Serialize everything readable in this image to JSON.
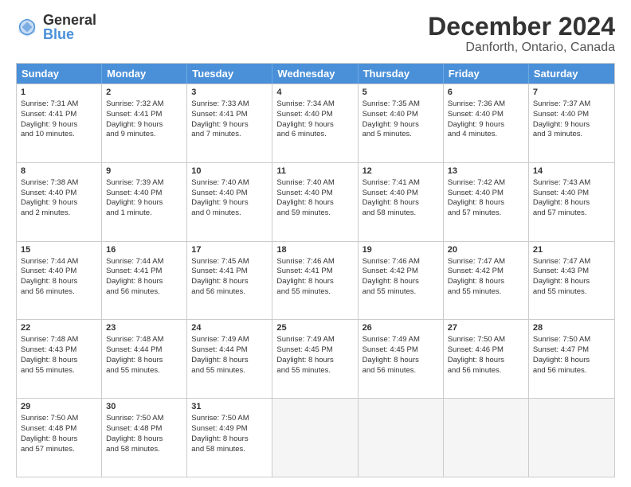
{
  "logo": {
    "general": "General",
    "blue": "Blue"
  },
  "title": "December 2024",
  "subtitle": "Danforth, Ontario, Canada",
  "days": [
    "Sunday",
    "Monday",
    "Tuesday",
    "Wednesday",
    "Thursday",
    "Friday",
    "Saturday"
  ],
  "weeks": [
    [
      {
        "num": "1",
        "lines": [
          "Sunrise: 7:31 AM",
          "Sunset: 4:41 PM",
          "Daylight: 9 hours",
          "and 10 minutes."
        ]
      },
      {
        "num": "2",
        "lines": [
          "Sunrise: 7:32 AM",
          "Sunset: 4:41 PM",
          "Daylight: 9 hours",
          "and 9 minutes."
        ]
      },
      {
        "num": "3",
        "lines": [
          "Sunrise: 7:33 AM",
          "Sunset: 4:41 PM",
          "Daylight: 9 hours",
          "and 7 minutes."
        ]
      },
      {
        "num": "4",
        "lines": [
          "Sunrise: 7:34 AM",
          "Sunset: 4:40 PM",
          "Daylight: 9 hours",
          "and 6 minutes."
        ]
      },
      {
        "num": "5",
        "lines": [
          "Sunrise: 7:35 AM",
          "Sunset: 4:40 PM",
          "Daylight: 9 hours",
          "and 5 minutes."
        ]
      },
      {
        "num": "6",
        "lines": [
          "Sunrise: 7:36 AM",
          "Sunset: 4:40 PM",
          "Daylight: 9 hours",
          "and 4 minutes."
        ]
      },
      {
        "num": "7",
        "lines": [
          "Sunrise: 7:37 AM",
          "Sunset: 4:40 PM",
          "Daylight: 9 hours",
          "and 3 minutes."
        ]
      }
    ],
    [
      {
        "num": "8",
        "lines": [
          "Sunrise: 7:38 AM",
          "Sunset: 4:40 PM",
          "Daylight: 9 hours",
          "and 2 minutes."
        ]
      },
      {
        "num": "9",
        "lines": [
          "Sunrise: 7:39 AM",
          "Sunset: 4:40 PM",
          "Daylight: 9 hours",
          "and 1 minute."
        ]
      },
      {
        "num": "10",
        "lines": [
          "Sunrise: 7:40 AM",
          "Sunset: 4:40 PM",
          "Daylight: 9 hours",
          "and 0 minutes."
        ]
      },
      {
        "num": "11",
        "lines": [
          "Sunrise: 7:40 AM",
          "Sunset: 4:40 PM",
          "Daylight: 8 hours",
          "and 59 minutes."
        ]
      },
      {
        "num": "12",
        "lines": [
          "Sunrise: 7:41 AM",
          "Sunset: 4:40 PM",
          "Daylight: 8 hours",
          "and 58 minutes."
        ]
      },
      {
        "num": "13",
        "lines": [
          "Sunrise: 7:42 AM",
          "Sunset: 4:40 PM",
          "Daylight: 8 hours",
          "and 57 minutes."
        ]
      },
      {
        "num": "14",
        "lines": [
          "Sunrise: 7:43 AM",
          "Sunset: 4:40 PM",
          "Daylight: 8 hours",
          "and 57 minutes."
        ]
      }
    ],
    [
      {
        "num": "15",
        "lines": [
          "Sunrise: 7:44 AM",
          "Sunset: 4:40 PM",
          "Daylight: 8 hours",
          "and 56 minutes."
        ]
      },
      {
        "num": "16",
        "lines": [
          "Sunrise: 7:44 AM",
          "Sunset: 4:41 PM",
          "Daylight: 8 hours",
          "and 56 minutes."
        ]
      },
      {
        "num": "17",
        "lines": [
          "Sunrise: 7:45 AM",
          "Sunset: 4:41 PM",
          "Daylight: 8 hours",
          "and 56 minutes."
        ]
      },
      {
        "num": "18",
        "lines": [
          "Sunrise: 7:46 AM",
          "Sunset: 4:41 PM",
          "Daylight: 8 hours",
          "and 55 minutes."
        ]
      },
      {
        "num": "19",
        "lines": [
          "Sunrise: 7:46 AM",
          "Sunset: 4:42 PM",
          "Daylight: 8 hours",
          "and 55 minutes."
        ]
      },
      {
        "num": "20",
        "lines": [
          "Sunrise: 7:47 AM",
          "Sunset: 4:42 PM",
          "Daylight: 8 hours",
          "and 55 minutes."
        ]
      },
      {
        "num": "21",
        "lines": [
          "Sunrise: 7:47 AM",
          "Sunset: 4:43 PM",
          "Daylight: 8 hours",
          "and 55 minutes."
        ]
      }
    ],
    [
      {
        "num": "22",
        "lines": [
          "Sunrise: 7:48 AM",
          "Sunset: 4:43 PM",
          "Daylight: 8 hours",
          "and 55 minutes."
        ]
      },
      {
        "num": "23",
        "lines": [
          "Sunrise: 7:48 AM",
          "Sunset: 4:44 PM",
          "Daylight: 8 hours",
          "and 55 minutes."
        ]
      },
      {
        "num": "24",
        "lines": [
          "Sunrise: 7:49 AM",
          "Sunset: 4:44 PM",
          "Daylight: 8 hours",
          "and 55 minutes."
        ]
      },
      {
        "num": "25",
        "lines": [
          "Sunrise: 7:49 AM",
          "Sunset: 4:45 PM",
          "Daylight: 8 hours",
          "and 55 minutes."
        ]
      },
      {
        "num": "26",
        "lines": [
          "Sunrise: 7:49 AM",
          "Sunset: 4:45 PM",
          "Daylight: 8 hours",
          "and 56 minutes."
        ]
      },
      {
        "num": "27",
        "lines": [
          "Sunrise: 7:50 AM",
          "Sunset: 4:46 PM",
          "Daylight: 8 hours",
          "and 56 minutes."
        ]
      },
      {
        "num": "28",
        "lines": [
          "Sunrise: 7:50 AM",
          "Sunset: 4:47 PM",
          "Daylight: 8 hours",
          "and 56 minutes."
        ]
      }
    ],
    [
      {
        "num": "29",
        "lines": [
          "Sunrise: 7:50 AM",
          "Sunset: 4:48 PM",
          "Daylight: 8 hours",
          "and 57 minutes."
        ]
      },
      {
        "num": "30",
        "lines": [
          "Sunrise: 7:50 AM",
          "Sunset: 4:48 PM",
          "Daylight: 8 hours",
          "and 58 minutes."
        ]
      },
      {
        "num": "31",
        "lines": [
          "Sunrise: 7:50 AM",
          "Sunset: 4:49 PM",
          "Daylight: 8 hours",
          "and 58 minutes."
        ]
      },
      {
        "num": "",
        "lines": []
      },
      {
        "num": "",
        "lines": []
      },
      {
        "num": "",
        "lines": []
      },
      {
        "num": "",
        "lines": []
      }
    ]
  ]
}
